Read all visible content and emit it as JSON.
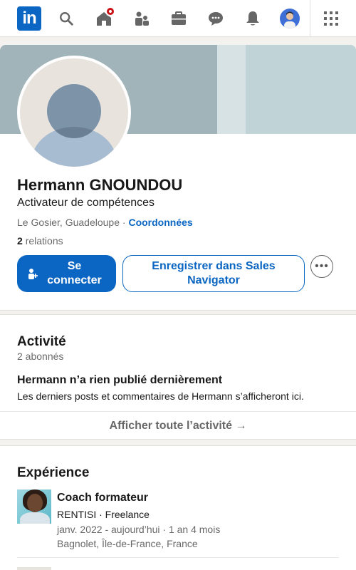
{
  "nav": {
    "logo_text": "in",
    "icons": [
      "search-icon",
      "home-icon",
      "network-icon",
      "jobs-icon",
      "messaging-icon",
      "notifications-icon",
      "me-avatar",
      "apps-grid-icon"
    ]
  },
  "colors": {
    "brand": "#0a66c2",
    "notification": "#cc1016",
    "background": "#f3f2ef"
  },
  "profile": {
    "name": "Hermann GNOUNDOU",
    "headline": "Activateur de compétences",
    "location": "Le Gosier, Guadeloupe",
    "separator": "·",
    "contact_link": "Coordonnées",
    "relations_count": "2",
    "relations_label": "relations",
    "connect_label": "Se connecter",
    "save_label": "Enregistrer dans Sales Navigator",
    "more_label": "•••"
  },
  "activity": {
    "title": "Activité",
    "followers": "2 abonnés",
    "empty_title": "Hermann n’a rien publié dernièrement",
    "empty_text": "Les derniers posts et commentaires de Hermann s’afficheront ici.",
    "show_all": "Afficher toute l’activité →"
  },
  "experience": {
    "title": "Expérience",
    "items": [
      {
        "role": "Coach formateur",
        "company": "RENTISI · Freelance",
        "dates": "janv. 2022 - aujourd’hui · 1 an 4 mois",
        "place": "Bagnolet, Île-de-France, France"
      }
    ]
  }
}
